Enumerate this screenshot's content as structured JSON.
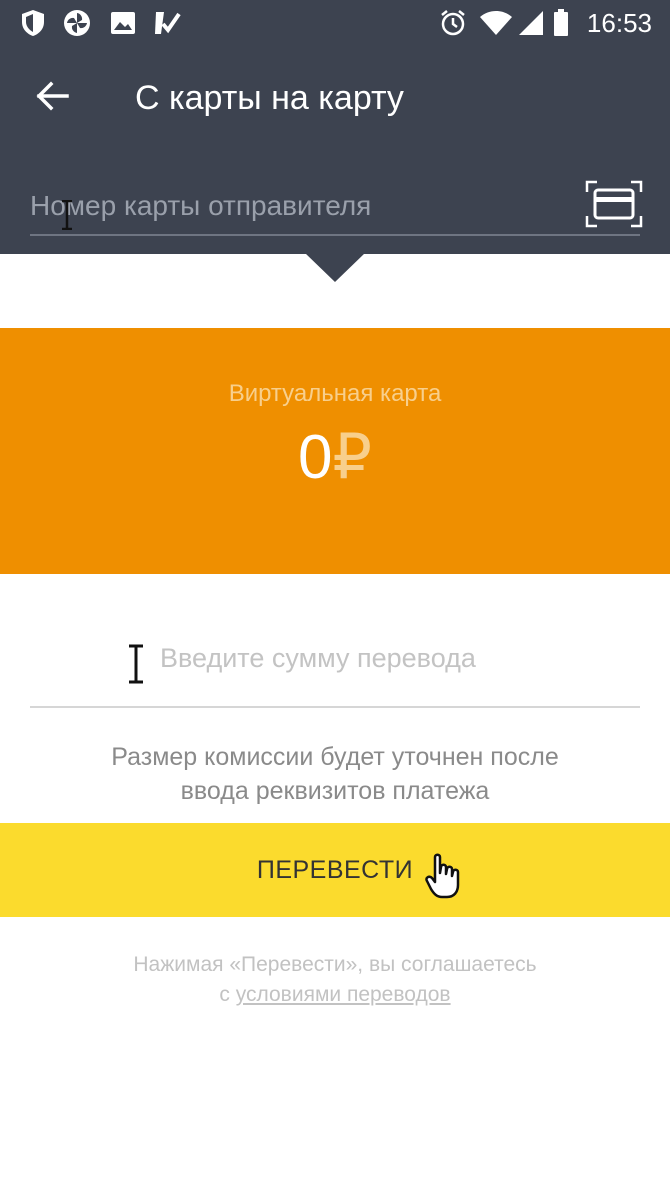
{
  "status_bar": {
    "time": "16:53",
    "icons": [
      "shield-icon",
      "pinwheel-icon",
      "image-icon",
      "check-tag-icon",
      "alarm-icon",
      "wifi-icon",
      "signal-icon",
      "battery-icon"
    ]
  },
  "header": {
    "title": "С карты на карту",
    "back_icon": "arrow-left-icon",
    "card_number_placeholder": "Номер карты отправителя",
    "scan_icon": "card-scan-icon"
  },
  "virtual_card": {
    "label": "Виртуальная карта",
    "balance": "0",
    "currency": "₽"
  },
  "amount": {
    "placeholder": "Введите сумму перевода"
  },
  "commission": {
    "line1": "Размер комиссии будет уточнен после",
    "line2": "ввода реквизитов платежа"
  },
  "transfer_button": {
    "label": "ПЕРЕВЕСТИ"
  },
  "terms": {
    "line1": "Нажимая «Перевести», вы соглашаетесь",
    "prefix": "с",
    "link": "условиями переводов"
  },
  "colors": {
    "header_bg": "#3d4350",
    "card_orange": "#ef8f00",
    "button_yellow": "#fbdb2d"
  }
}
